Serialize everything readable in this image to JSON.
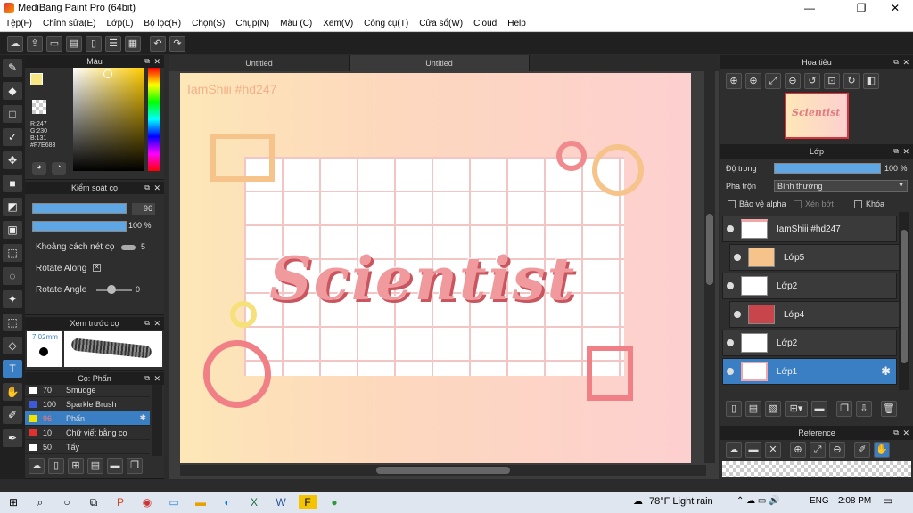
{
  "window": {
    "title": "MediBang Paint Pro (64bit)",
    "minimize": "—",
    "maximize": "❐",
    "close": "✕"
  },
  "menu": [
    "Tệp(F)",
    "Chỉnh sửa(E)",
    "Lớp(L)",
    "Bộ lọc(R)",
    "Chọn(S)",
    "Chụp(N)",
    "Màu (C)",
    "Xem(V)",
    "Công cụ(T)",
    "Cửa sổ(W)",
    "Cloud",
    "Help"
  ],
  "panels": {
    "color": {
      "title": "Màu",
      "rgb": {
        "r": "R:247",
        "g": "G:230",
        "b": "B:131",
        "hex": "#F7E683"
      }
    },
    "brush_control": {
      "title": "Kiểm soát cọ",
      "size": "96",
      "opacity": "100 %",
      "spacing_label": "Khoảng cách nét cọ",
      "spacing_value": "5",
      "rotate_along_label": "Rotate Along",
      "rotate_angle_label": "Rotate Angle",
      "rotate_angle_value": "0"
    },
    "preview": {
      "title": "Xem trước cọ",
      "size": "7.02mm"
    },
    "brushes": {
      "title": "Cọ: Phấn",
      "items": [
        {
          "num": "70",
          "name": "Smudge",
          "color": "#ffffff"
        },
        {
          "num": "100",
          "name": "Sparkle Brush",
          "color": "#3b5bdb"
        },
        {
          "num": "96",
          "name": "Phấn",
          "color": "#f2e200"
        },
        {
          "num": "10",
          "name": "Chữ viết bằng cọ",
          "color": "#e03131"
        },
        {
          "num": "50",
          "name": "Tẩy",
          "color": "#ffffff"
        }
      ]
    }
  },
  "canvas": {
    "tabs": [
      "Untitled",
      "Untitled"
    ],
    "watermark": "IamShiii #hd247",
    "word": "Scientist"
  },
  "navigator": {
    "title": "Hoa tiêu"
  },
  "layers": {
    "title": "Lớp",
    "opacity_label": "Độ trong",
    "opacity_value": "100 %",
    "blend_label": "Pha trộn",
    "blend_value": "Bình thường",
    "protect_alpha": "Bảo vệ alpha",
    "clip": "Xén bớt",
    "lock": "Khóa",
    "items": [
      "IamShiii #hd247",
      "Lớp5",
      "Lớp2",
      "Lớp4",
      "Lớp2",
      "Lớp1"
    ]
  },
  "reference": {
    "title": "Reference"
  },
  "taskbar": {
    "weather": "78°F  Light rain",
    "lang": "ENG",
    "time": "2:08 PM"
  }
}
